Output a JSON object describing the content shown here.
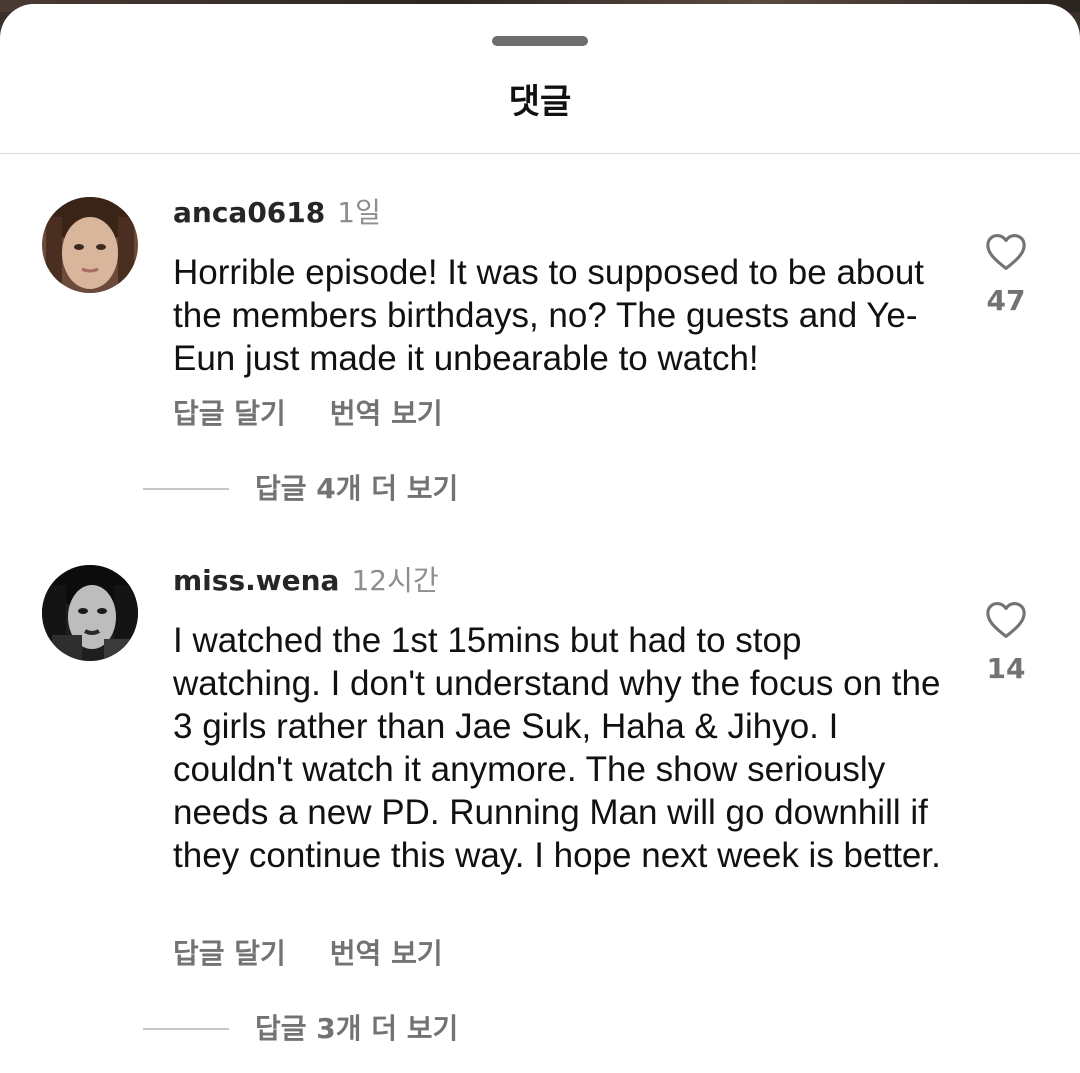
{
  "sheet": {
    "title": "댓글"
  },
  "comments": [
    {
      "username": "anca0618",
      "time": "1일",
      "text": "Horrible episode! It was to supposed to be about the members birthdays, no? The guests and Ye-Eun just made it unbearable to watch!",
      "likes": "47",
      "reply_label": "답글 달기",
      "translate_label": "번역 보기",
      "more_replies": "답글 4개 더 보기"
    },
    {
      "username": "miss.wena",
      "time": "12시간",
      "text": "I watched the 1st 15mins but had to stop watching. I don't understand why the focus on the 3 girls rather than Jae Suk, Haha & Jihyo. I couldn't watch it anymore. The show seriously needs a new PD. Running Man will go downhill if they continue this way. I hope next week is better.",
      "likes": "14",
      "reply_label": "답글 달기",
      "translate_label": "번역 보기",
      "more_replies": "답글 3개 더 보기"
    }
  ],
  "icons": {
    "like": "heart-outline-icon",
    "handle": "drag-handle"
  },
  "colors": {
    "text_primary": "#111111",
    "text_secondary": "#737373",
    "timestamp": "#8e8e8e",
    "divider": "#dbdbdb"
  }
}
